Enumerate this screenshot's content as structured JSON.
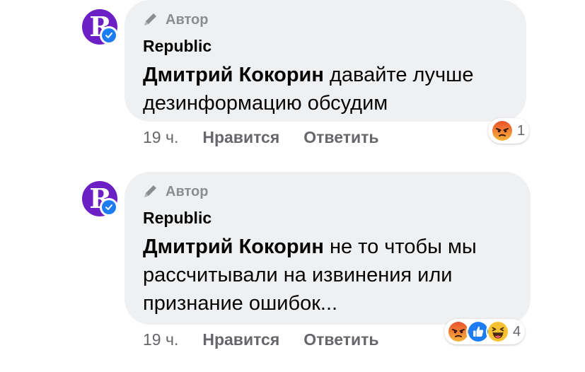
{
  "comments": [
    {
      "author_badge": "Автор",
      "page_name": "Republic",
      "mention": "Дмитрий Кокорин",
      "text": " давайте лучше дезинформацию обсудим",
      "time": "19 ч.",
      "like_label": "Нравится",
      "reply_label": "Ответить",
      "reactions": [
        "angry-icon"
      ],
      "reaction_count": "1"
    },
    {
      "author_badge": "Автор",
      "page_name": "Republic",
      "mention": "Дмитрий Кокорин",
      "text": " не то чтобы мы рассчитывали на извинения или признание ошибок...",
      "time": "19 ч.",
      "like_label": "Нравится",
      "reply_label": "Ответить",
      "reactions": [
        "angry-icon",
        "like-icon",
        "haha-icon"
      ],
      "reaction_count": "4"
    }
  ],
  "avatar_logo": "R",
  "colors": {
    "avatar_bg": "#6b1fc5",
    "verified_blue": "#1d7cf2",
    "bubble_bg": "#eff0f2",
    "meta_gray": "#65676b"
  }
}
